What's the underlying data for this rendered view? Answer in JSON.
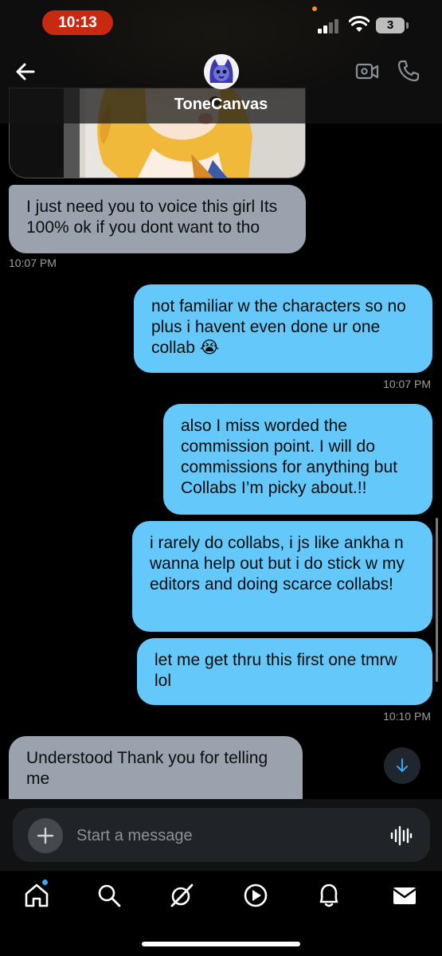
{
  "status_bar": {
    "time": "10:13",
    "battery": "3"
  },
  "header": {
    "contact_name": "ToneCanvas"
  },
  "messages": [
    {
      "direction": "in",
      "text": "I just need you to voice this girl Its 100% ok if you dont want to tho",
      "time": "10:07 PM"
    },
    {
      "direction": "out",
      "text": "not familiar w the characters so no plus i havent even done ur one collab 😭",
      "time": "10:07 PM"
    },
    {
      "direction": "out",
      "text": "also I miss worded the commission point. I will do commissions for anything but Collabs I’m picky about.!!"
    },
    {
      "direction": "out",
      "text": "i rarely do collabs, i js like ankha n wanna help out but i do stick w my editors and doing scarce collabs!"
    },
    {
      "direction": "out",
      "text": "let me get thru this first one tmrw lol",
      "time": "10:10 PM"
    },
    {
      "direction": "in",
      "text": "Understood Thank you for telling me"
    }
  ],
  "composer": {
    "placeholder": "Start a message"
  },
  "nav": {
    "items": [
      "home-icon",
      "search-icon",
      "grok-icon",
      "play-icon",
      "bell-icon",
      "mail-icon"
    ],
    "active": "mail-icon"
  },
  "colors": {
    "incoming_bubble": "#9aa3ad",
    "outgoing_bubble": "#64c8fb",
    "time_pill": "#c9290f",
    "accent": "#3ea7f5"
  }
}
